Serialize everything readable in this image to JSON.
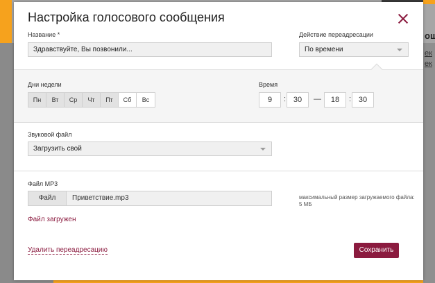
{
  "background": {
    "fragment_1": "ощ",
    "fragment_2": "ек",
    "fragment_3": "ек"
  },
  "dialog": {
    "title": "Настройка голосового сообщения",
    "name_label": "Название *",
    "name_value": "Здравствуйте, Вы позвонили...",
    "redirect_label": "Действие переадресации",
    "redirect_value": "По времени",
    "days_label": "Дни недели",
    "days": [
      {
        "label": "Пн",
        "selected": true
      },
      {
        "label": "Вт",
        "selected": true
      },
      {
        "label": "Ср",
        "selected": true
      },
      {
        "label": "Чт",
        "selected": true
      },
      {
        "label": "Пт",
        "selected": true
      },
      {
        "label": "Сб",
        "selected": false
      },
      {
        "label": "Вс",
        "selected": false
      }
    ],
    "time_label": "Время",
    "time": {
      "from_h": "9",
      "from_m": "30",
      "to_h": "18",
      "to_m": "30",
      "colon": ":",
      "dash": "—"
    },
    "sound_label": "Звуковой файл",
    "sound_value": "Загрузить свой",
    "mp3_label": "Файл MP3",
    "file_button": "Файл",
    "file_name": "Приветствие.mp3",
    "file_hint": "максимальный размер загружаемого файла: 5 МБ",
    "file_status": "Файл загружен",
    "delete_link": "Удалить переадресацию",
    "save_button": "Сохранить"
  },
  "colors": {
    "accent": "#8b1b3f",
    "background_orange": "#f6a21d",
    "overlay": "#8a8a8a"
  },
  "icons": {
    "close": "close-icon",
    "dropdown": "chevron-down-icon"
  }
}
